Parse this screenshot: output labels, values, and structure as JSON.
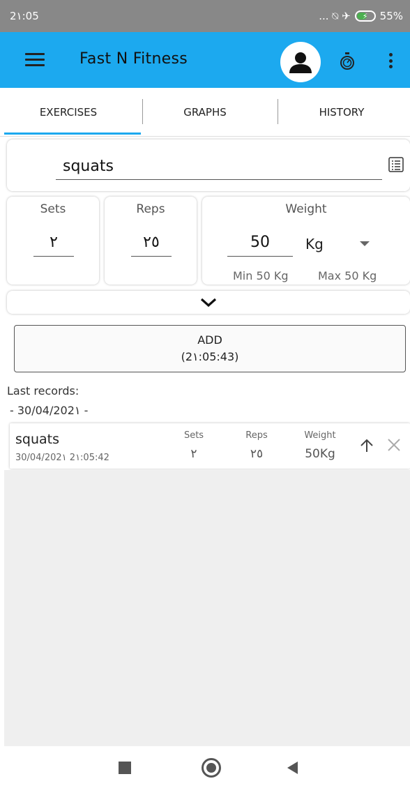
{
  "status_bar": {
    "time": "2١:05",
    "icons_text": "... ⍉ ✈",
    "battery": "55%"
  },
  "app_bar": {
    "title": "Fast N Fitness"
  },
  "tabs": [
    {
      "label": "EXERCISES",
      "selected": true
    },
    {
      "label": "GRAPHS",
      "selected": false
    },
    {
      "label": "HISTORY",
      "selected": false
    }
  ],
  "exercise": {
    "value": "squats"
  },
  "sets": {
    "label": "Sets",
    "value": "٢"
  },
  "reps": {
    "label": "Reps",
    "value": "٢٥"
  },
  "weight": {
    "label": "Weight",
    "value": "50",
    "unit": "Kg",
    "min": "Min 50 Kg",
    "max": "Max 50 Kg"
  },
  "add_button": {
    "label": "ADD",
    "time": "(2١:05:43)"
  },
  "records": {
    "heading": "Last records:",
    "date_header": "- 30/04/202١ -",
    "items": [
      {
        "name": "squats",
        "timestamp": "30/04/202١ 2١:05:42",
        "sets_label": "Sets",
        "sets": "٢",
        "reps_label": "Reps",
        "reps": "٢٥",
        "weight_label": "Weight",
        "weight": "50Kg"
      }
    ]
  },
  "colors": {
    "accent": "#1ca9ef",
    "status_bar": "#888888",
    "background": "#efefef"
  }
}
